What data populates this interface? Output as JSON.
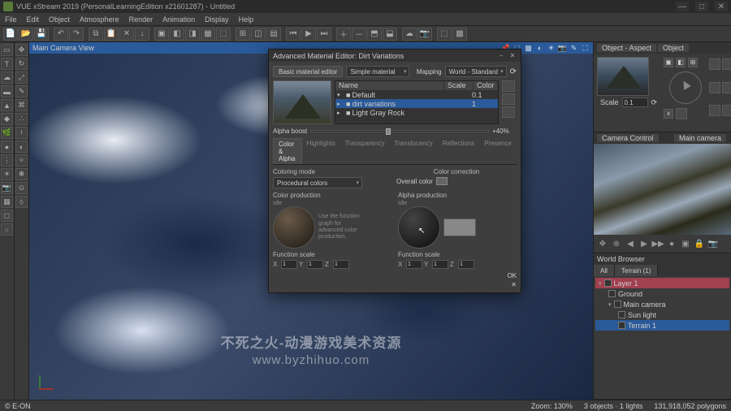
{
  "window": {
    "title": "VUE xStream 2019 (PersonalLearningEdition x21601287) - Untitled",
    "min": "—",
    "max": "□",
    "close": "✕"
  },
  "menu": [
    "File",
    "Edit",
    "Object",
    "Atmosphere",
    "Render",
    "Animation",
    "Display",
    "Help"
  ],
  "viewport": {
    "title": "Main Camera View"
  },
  "watermark": {
    "l1": "不死之火-动漫游戏美术资源",
    "l2": "www.byzhihuo.com"
  },
  "panels": {
    "aspect": {
      "tab1": "Object - Aspect",
      "tab2": "Object",
      "scale_label": "Scale",
      "scale_val": "0.1"
    },
    "camera": {
      "tab1": "Camera Control",
      "tab2": "Main camera"
    },
    "world": {
      "title": "World Browser",
      "tab": "Terrain (1)",
      "rows": [
        "Layer 1",
        "Ground",
        "Main camera",
        "Sun light",
        "Terrain 1"
      ]
    }
  },
  "dialog": {
    "title": "Advanced Material Editor: Dirt Variations",
    "basic": "Basic material editor",
    "type": "Simple material",
    "type_v": "▾",
    "mapping": "Mapping",
    "mapping_v": "World - Standard",
    "cols": {
      "name": "Name",
      "scale": "Scale",
      "color": "Color"
    },
    "layers": [
      {
        "name": "Default",
        "scale": "0.1"
      },
      {
        "name": "dirt variations",
        "scale": "1"
      },
      {
        "name": "Light Gray Rock",
        "scale": ""
      }
    ],
    "alpha_boost": "Alpha boost",
    "alpha_val": "+40%",
    "tabs": [
      "Color & Alpha",
      "Highlights",
      "Transparency",
      "Translucency",
      "Reflections",
      "Presence"
    ],
    "coloring": "Coloring mode",
    "coloring_v": "Procedural colors",
    "colorcorr": "Color correction",
    "overall": "Overall color",
    "colorprod": "Color production",
    "alphaprod": "Alpha production",
    "hint": "Use the function graph for advanced color production.",
    "fscale": "Function scale",
    "idle": "Idle",
    "x": "X",
    "y": "Y",
    "z": "Z",
    "v1": "1",
    "ok": "OK",
    "cancel": "✕"
  },
  "status": {
    "left": "© E-ON",
    "zoom": "Zoom: 130%",
    "objs": "3 objects · 1 lights",
    "polys": "131,918,052 polygons"
  }
}
